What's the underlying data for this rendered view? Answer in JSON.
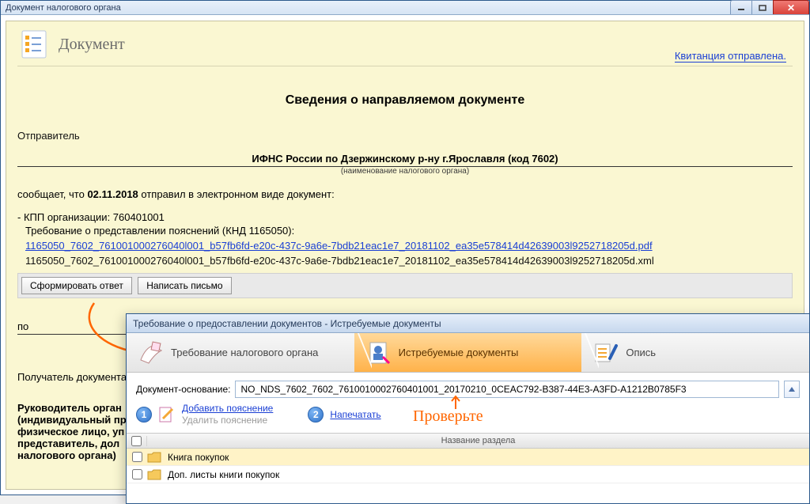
{
  "window": {
    "title": "Документ налогового органа"
  },
  "header": {
    "doc_label": "Документ",
    "receipt_link": "Квитанция отправлена."
  },
  "main": {
    "heading": "Сведения о направляемом документе",
    "sender_label": "Отправитель",
    "sender_value": "ИФНС России по Дзержинскому р-ну г.Ярославля (код 7602)",
    "sender_sub": "(наименование налогового органа)",
    "sent_prefix": "сообщает, что ",
    "sent_date": "02.11.2018",
    "sent_suffix": " отправил в электронном виде документ:",
    "kpp_line": "КПП организации: 760401001",
    "req_line": "Требование о представлении пояснений (КНД 1165050):",
    "pdf_link": "1165050_7602_761001000276040l001_b57fb6fd-e20c-437c-9a6e-7bdb21eac1e7_20181102_ea35e578414d42639003l9252718205d.pdf",
    "xml_line": "1165050_7602_761001000276040l001_b57fb6fd-e20c-437c-9a6e-7bdb21eac1e7_20181102_ea35e578414d42639003l9252718205d.xml",
    "btn_form": "Сформировать ответ",
    "btn_letter": "Написать письмо",
    "po": "по",
    "recipient_label": "Получатель документа",
    "footer1": "Руководитель орган",
    "footer2": "(индивидуальный пр",
    "footer3": "физическое лицо, уп",
    "footer4": "представитель, дол",
    "footer5": "налогового органа)"
  },
  "dialog": {
    "title": "Требование о предоставлении документов - Истребуемые документы",
    "steps": {
      "s1": "Требование налогового органа",
      "s2": "Истребуемые документы",
      "s3": "Опись"
    },
    "basis_label": "Документ-основание:",
    "basis_value": "NO_NDS_7602_7602_7610010002760401001_20170210_0CEAC792-B387-44E3-A3FD-A1212B0785F3",
    "badge1": "1",
    "add_expl": "Добавить пояснение",
    "del_expl": "Удалить пояснение",
    "badge2": "2",
    "print": "Напечатать",
    "grid_header": "Название раздела",
    "row1": "Книга покупок",
    "row2": "Доп. листы книги покупок"
  },
  "annotation": {
    "check": "Проверьте"
  }
}
